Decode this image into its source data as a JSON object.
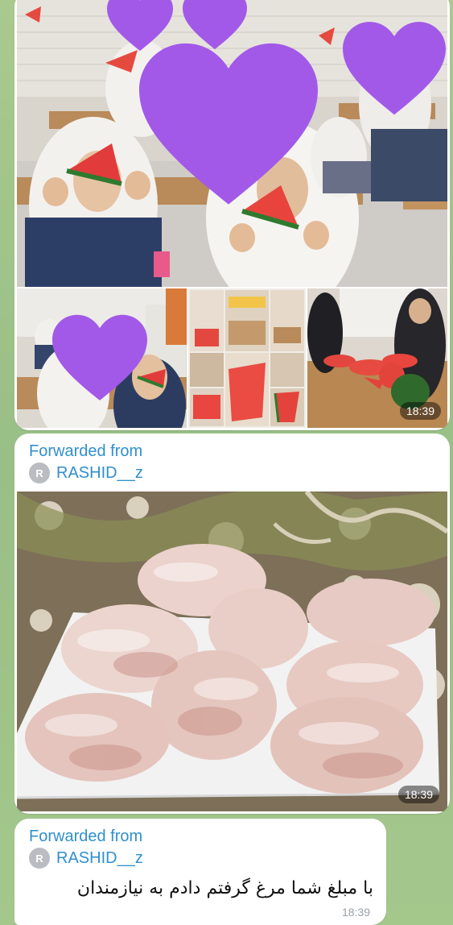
{
  "album": {
    "time": "18:39",
    "photos": [
      {
        "subject": "girls holding watermelon slices in classroom",
        "color": "#c9b6a2"
      },
      {
        "subject": "classroom with girls eating watermelon",
        "color": "#bfa98d"
      },
      {
        "subject": "collage of watermelon photos",
        "color": "#d7c3b0"
      },
      {
        "subject": "women cutting watermelon on table",
        "color": "#a98a6d"
      }
    ]
  },
  "forwarded_photo": {
    "forwarded_label": "Forwarded from",
    "avatar_letter": "R",
    "username": "RASHID__z",
    "subject": "bags of raw chicken on a tray",
    "time": "18:39"
  },
  "forwarded_text": {
    "forwarded_label": "Forwarded from",
    "avatar_letter": "R",
    "username": "RASHID__z",
    "text": "با مبلغ شما مرغ  گرفتم دادم به نیازمندان",
    "time": "18:39"
  },
  "colors": {
    "accent": "#2f8fd0",
    "heart": "#a259e8",
    "chat_bg": "#9fc28a"
  }
}
